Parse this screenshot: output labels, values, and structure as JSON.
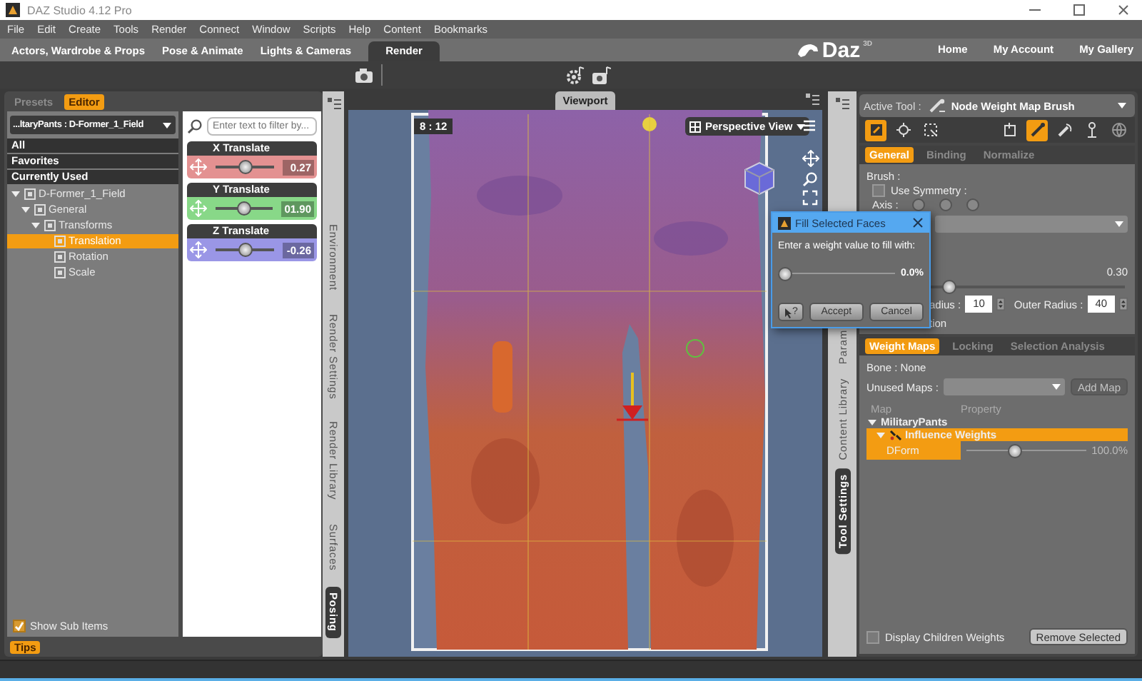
{
  "window": {
    "title": "DAZ Studio 4.12 Pro"
  },
  "menu": [
    "File",
    "Edit",
    "Create",
    "Tools",
    "Render",
    "Connect",
    "Window",
    "Scripts",
    "Help",
    "Content",
    "Bookmarks"
  ],
  "rooms": [
    {
      "label": "Actors, Wardrobe & Props",
      "selected": false
    },
    {
      "label": "Pose & Animate",
      "selected": false
    },
    {
      "label": "Lights & Cameras",
      "selected": false
    },
    {
      "label": "Render",
      "selected": true
    }
  ],
  "brand": {
    "logo": "Daz",
    "logo_sup": "3D",
    "links": [
      "Home",
      "My Account",
      "My Gallery"
    ]
  },
  "left_panel": {
    "tabs": [
      {
        "label": "Presets",
        "selected": false
      },
      {
        "label": "Editor",
        "selected": true
      }
    ],
    "node_selector": "...ltaryPants : D-Former_1_Field",
    "categories": [
      "All",
      "Favorites",
      "Currently Used"
    ],
    "tree": [
      {
        "label": "D-Former_1_Field",
        "expanded": true,
        "selected": false,
        "children": [
          {
            "label": "General",
            "expanded": true,
            "selected": false,
            "children": [
              {
                "label": "Transforms",
                "expanded": true,
                "selected": false,
                "children": [
                  {
                    "label": "Translation",
                    "selected": true
                  },
                  {
                    "label": "Rotation",
                    "selected": false
                  },
                  {
                    "label": "Scale",
                    "selected": false
                  }
                ]
              }
            ]
          }
        ]
      }
    ],
    "show_sub_items": {
      "label": "Show Sub Items",
      "checked": true
    },
    "filter": {
      "placeholder": "Enter text to filter by..."
    },
    "parameters": [
      {
        "name": "X Translate",
        "value": "0.27",
        "level": 0.52,
        "color": "#e39191"
      },
      {
        "name": "Y Translate",
        "value": "01.90",
        "level": 0.5,
        "color": "#88d888"
      },
      {
        "name": "Z Translate",
        "value": "-0.26",
        "level": 0.5,
        "color": "#9a96e6"
      }
    ],
    "tips": "Tips"
  },
  "left_side_tabs": [
    {
      "label": "Environment",
      "selected": false
    },
    {
      "label": "Render Settings",
      "selected": false
    },
    {
      "label": "Render Library",
      "selected": false
    },
    {
      "label": "Surfaces",
      "selected": false
    },
    {
      "label": "Posing",
      "selected": true
    }
  ],
  "viewport": {
    "tab": "Viewport",
    "frame_label": "8 : 12",
    "view_menu": "Perspective View"
  },
  "right_side_tabs": [
    {
      "label": "Param",
      "selected": false
    },
    {
      "label": "Content Library",
      "selected": false
    },
    {
      "label": "Tool Settings",
      "selected": true
    }
  ],
  "right_panel": {
    "active_tool_label": "Active Tool :",
    "active_tool": "Node Weight Map Brush",
    "tools_left": [
      {
        "kind": "weight-paint",
        "selected": true
      },
      {
        "kind": "node",
        "selected": false
      },
      {
        "kind": "marquee",
        "selected": false
      }
    ],
    "tools_right": [
      {
        "kind": "fill",
        "selected": false
      },
      {
        "kind": "brush",
        "selected": true
      },
      {
        "kind": "smooth",
        "selected": false
      },
      {
        "kind": "pin",
        "selected": false
      },
      {
        "kind": "globe",
        "selected": false
      }
    ],
    "tabs": [
      {
        "label": "General",
        "selected": true
      },
      {
        "label": "Binding",
        "selected": false
      },
      {
        "label": "Normalize",
        "selected": false
      }
    ],
    "brush_label": "Brush :",
    "use_symmetry": {
      "label": "Use Symmetry :",
      "checked": false
    },
    "axis": {
      "label": "Axis :",
      "options": [
        {
          "selected": false
        },
        {
          "selected": false
        },
        {
          "selected": false
        }
      ]
    },
    "strength": {
      "reading": "0.30",
      "level": 0.3
    },
    "inner_radius": {
      "label": "adius :",
      "value": "10"
    },
    "outer_radius": {
      "label": "Outer Radius :",
      "value": "40"
    },
    "option_label": "tion",
    "map_tabs": [
      {
        "label": "Weight Maps",
        "selected": true
      },
      {
        "label": "Locking",
        "selected": false
      },
      {
        "label": "Selection Analysis",
        "selected": false
      }
    ],
    "bone": "Bone : None",
    "unused_maps_label": "Unused Maps :",
    "add_map": {
      "label": "Add Map",
      "disabled": true
    },
    "columns": [
      "Map",
      "Property"
    ],
    "map_tree": [
      {
        "label": "MilitaryPants",
        "expanded": true,
        "selected": false,
        "children": [
          {
            "label": "Influence Weights",
            "expanded": true,
            "selected": true,
            "children": [
              {
                "label": "DForm",
                "selected": true,
                "level": 0.4,
                "reading": "100.0%"
              }
            ]
          }
        ]
      }
    ],
    "display_children_weights": {
      "label": "Display Children Weights",
      "checked": false
    },
    "remove_selected": "Remove Selected"
  },
  "dialog": {
    "title": "Fill Selected Faces",
    "prompt": "Enter a weight value to fill with:",
    "level": 0,
    "reading": "0.0%",
    "help_label": "?",
    "buttons": [
      "Accept",
      "Cancel"
    ]
  }
}
